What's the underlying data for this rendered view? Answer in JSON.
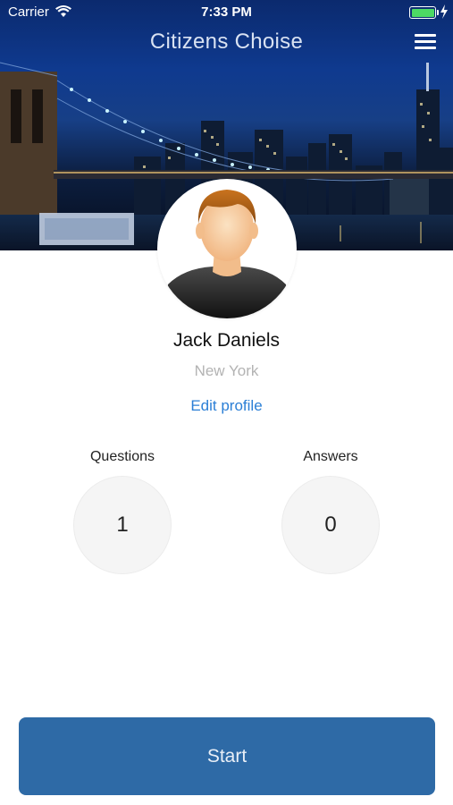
{
  "status_bar": {
    "carrier": "Carrier",
    "time": "7:33 PM",
    "battery_color": "#4cd964"
  },
  "nav": {
    "title": "Citizens Choise",
    "menu_icon": "hamburger-menu-icon"
  },
  "header_image": "city-skyline-bridge-night",
  "profile": {
    "name": "Jack Daniels",
    "city": "New York",
    "edit_label": "Edit profile",
    "avatar_icon": "default-male-avatar"
  },
  "stats": {
    "questions_label": "Questions",
    "questions_value": "1",
    "answers_label": "Answers",
    "answers_value": "0"
  },
  "start_label": "Start",
  "colors": {
    "accent": "#2b7fd6",
    "button": "#2e6aa6"
  }
}
